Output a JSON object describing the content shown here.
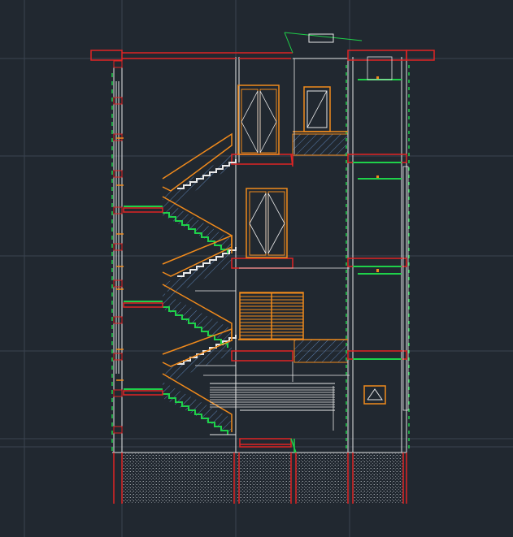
{
  "app": {
    "title": ""
  },
  "drawing": {
    "type": "building-section",
    "floors": 4,
    "stair_flights": 6,
    "foundation_pattern": "hatched",
    "colors": {
      "background": "#212830",
      "grid": "#3a4350",
      "wall_red": "#e02424",
      "wall_white": "#e8e8e8",
      "accent_orange": "#f08a1c",
      "green": "#1fd14a",
      "hatch_blue": "#5a7fb0",
      "hatch_white": "#9aa0a6"
    }
  }
}
